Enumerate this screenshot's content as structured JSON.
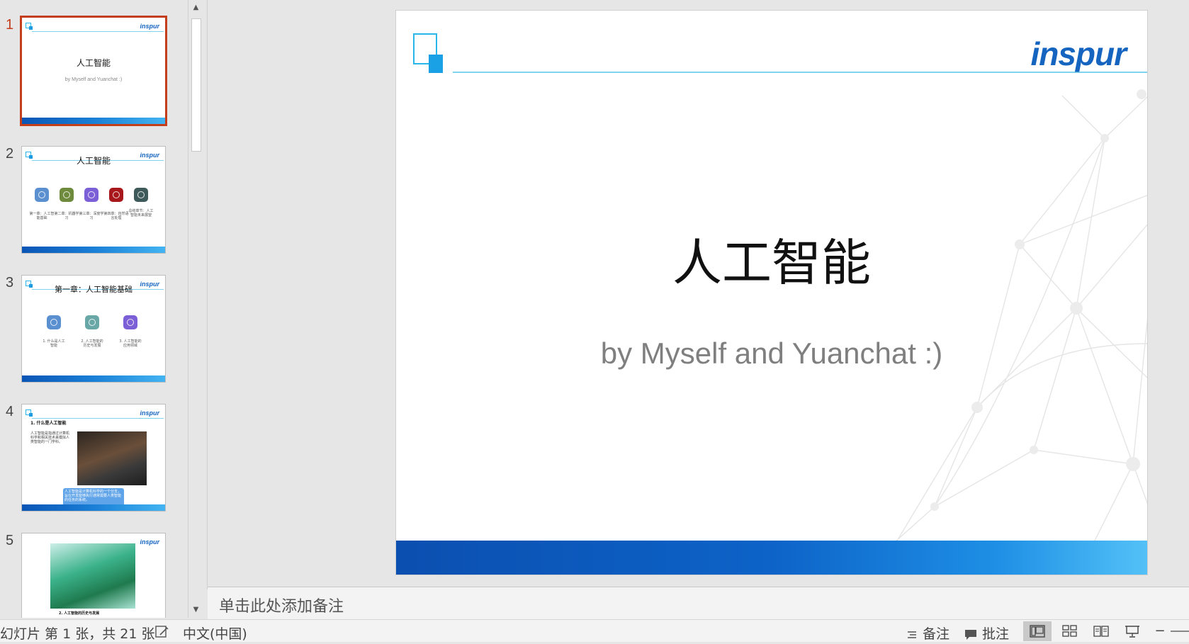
{
  "thumbnails": [
    {
      "number": "1",
      "logo": "inspur",
      "title": "人工智能",
      "subtitle": "by Myself and Yuanchat :)"
    },
    {
      "number": "2",
      "logo": "inspur",
      "title": "人工智能",
      "captions": [
        "第一章：人工智能基础",
        "第二章：机器学习",
        "第三章：深度学习",
        "第四章：自然语言处理",
        "总结章节：人工智能未来展望"
      ]
    },
    {
      "number": "3",
      "logo": "inspur",
      "title": "第一章：人工智能基础",
      "captions": [
        "1. 什么是人工智能",
        "2. 人工智能的历史与发展",
        "3. 人工智能的应用领域"
      ]
    },
    {
      "number": "4",
      "logo": "inspur",
      "title": "1. 什么是人工智能",
      "body": "人工智能是指通过计算机科学和相关技术来模拟人类智能的一门学科。",
      "callout": "人工智能是计算机科学的一个分支，旨在开发能够执行通常需要人类智能的任务的系统。"
    },
    {
      "number": "5",
      "logo": "inspur",
      "caption": "2. 人工智能的历史与发展"
    }
  ],
  "slide": {
    "logo": "inspur",
    "title": "人工智能",
    "subtitle": "by Myself and Yuanchat :)"
  },
  "notes": {
    "placeholder": "单击此处添加备注"
  },
  "statusbar": {
    "slide_info": "幻灯片 第 1 张，共 21 张",
    "language": "中文(中国)",
    "notes_label": "备注",
    "comments_label": "批注"
  },
  "colors": {
    "accent": "#c43e1c",
    "brand_blue": "#1565c0",
    "band_light": "#53c1f7"
  }
}
